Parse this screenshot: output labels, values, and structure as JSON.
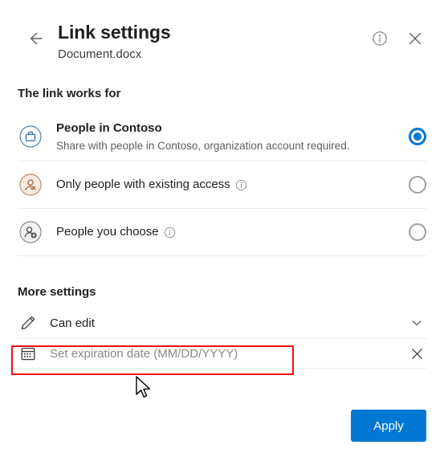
{
  "header": {
    "back_icon": "arrow-left-icon",
    "title": "Link settings",
    "subtitle": "Document.docx",
    "info_icon": "info-icon",
    "close_icon": "close-icon"
  },
  "link_works_for": {
    "section_title": "The link works for",
    "options": [
      {
        "icon": "briefcase-circle-icon",
        "label": "People in Contoso",
        "description": "Share with people in Contoso, organization account required.",
        "has_info": false,
        "selected": true
      },
      {
        "icon": "person-check-circle-icon",
        "label": "Only people with existing access",
        "description": "",
        "has_info": true,
        "selected": false
      },
      {
        "icon": "person-add-circle-icon",
        "label": "People you choose",
        "description": "",
        "has_info": true,
        "selected": false
      }
    ]
  },
  "more_settings": {
    "section_title": "More settings",
    "permission_row": {
      "icon": "pencil-icon",
      "label": "Can edit",
      "trailing_icon": "chevron-down-icon"
    },
    "expiration_row": {
      "icon": "calendar-icon",
      "placeholder": "Set expiration date (MM/DD/YYYY)",
      "trailing_icon": "close-icon",
      "highlighted": true
    }
  },
  "footer": {
    "apply_label": "Apply"
  },
  "colors": {
    "accent": "#0078d4",
    "highlight": "#ee1111",
    "briefcase_icon": "#2b6ca3",
    "person_check_icon": "#a25b32",
    "person_add_icon": "#605e5c",
    "text_primary": "#201f1e",
    "text_secondary": "#605e5c",
    "placeholder": "#8a8886",
    "divider": "#edebe9"
  },
  "cursor": {
    "type": "arrow-pointer"
  }
}
